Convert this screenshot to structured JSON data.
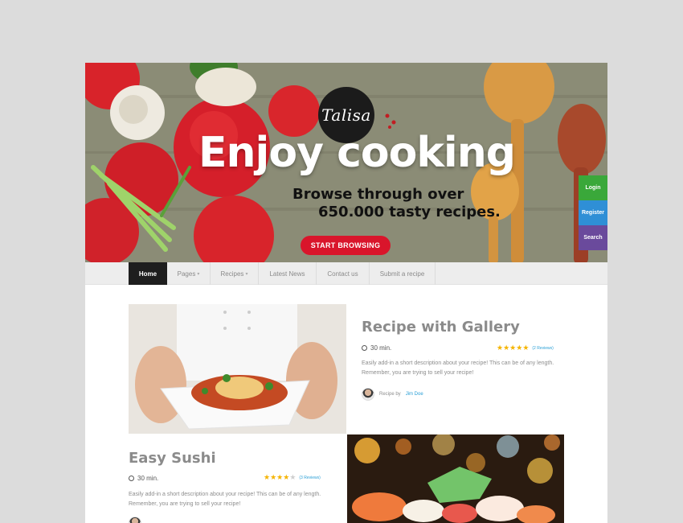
{
  "hero": {
    "logo": "Talisa",
    "title": "Enjoy cooking",
    "subtitle_line1": "Browse through over",
    "subtitle_line2": "650.000 tasty recipes.",
    "cta_label": "START BROWSING"
  },
  "side_tabs": [
    {
      "label": "Login",
      "color": "#3aa83a"
    },
    {
      "label": "Register",
      "color": "#2f8fd6"
    },
    {
      "label": "Search",
      "color": "#6a4a9c"
    }
  ],
  "nav": {
    "items": [
      {
        "label": "Home",
        "active": true
      },
      {
        "label": "Pages",
        "dropdown": true
      },
      {
        "label": "Recipes",
        "dropdown": true
      },
      {
        "label": "Latest News"
      },
      {
        "label": "Contact us"
      },
      {
        "label": "Submit a recipe"
      }
    ]
  },
  "recipes": [
    {
      "title": "Recipe with Gallery",
      "time": "30 min.",
      "rating": 4.5,
      "reviews": "(2 Reviews)",
      "description_line1": "Easily add-in a short description about your recipe! This can be of any length.",
      "description_line2": "Remember, you are trying to sell your recipe!",
      "author_prefix": "Recipe by",
      "author_name": "Jim Doe"
    },
    {
      "title": "Easy Sushi",
      "time": "30 min.",
      "rating": 3.5,
      "reviews": "(3 Reviews)",
      "description_line1": "Easily add-in a short description about your recipe! This can be of any length.",
      "description_line2": "Remember, you are trying to sell your recipe!"
    }
  ],
  "colors": {
    "accent_red": "#d9152b",
    "star_yellow": "#f5b400",
    "link_blue": "#2a9fd6",
    "nav_active": "#1e1e1e"
  }
}
